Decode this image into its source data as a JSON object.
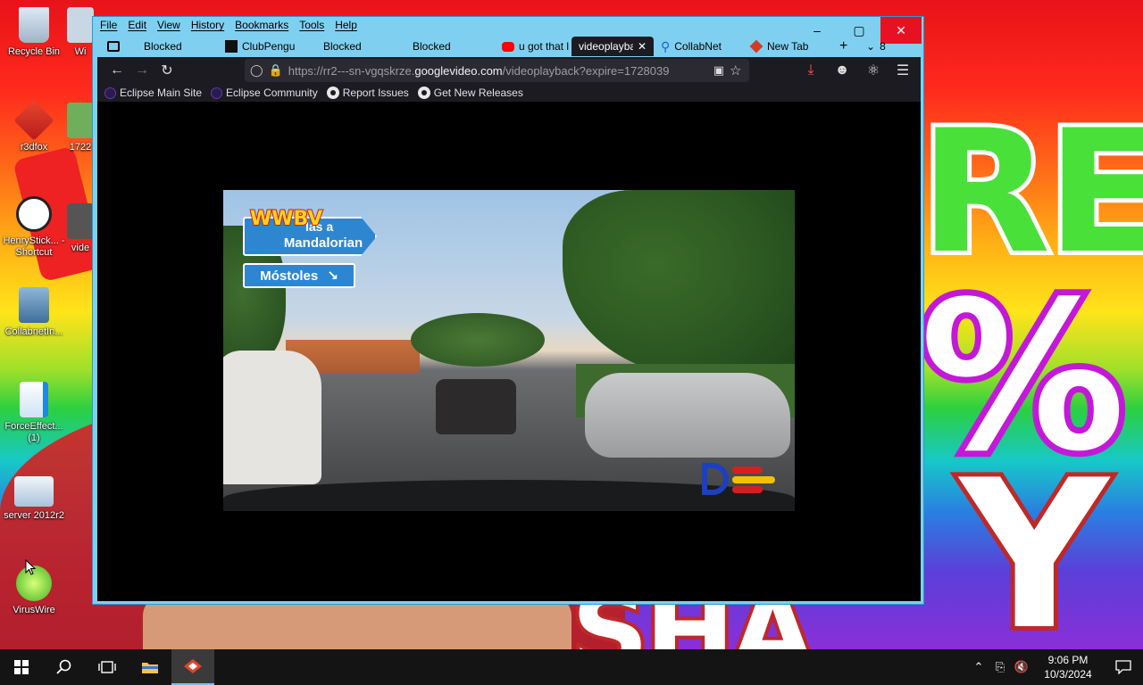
{
  "desktop": {
    "icons": [
      {
        "label": "Recycle Bin"
      },
      {
        "label": "Wi"
      },
      {
        "label": "r3dfox"
      },
      {
        "label": "1722"
      },
      {
        "label": "HenryStick... - Shortcut"
      },
      {
        "label": "vide"
      },
      {
        "label": "CollabnetIn..."
      },
      {
        "label": "ForceEffect... (1)"
      },
      {
        "label": "server 2012r2"
      },
      {
        "label": "VirusWire"
      }
    ]
  },
  "browser": {
    "menu": [
      "File",
      "Edit",
      "View",
      "History",
      "Bookmarks",
      "Tools",
      "Help"
    ],
    "window_controls": {
      "minimize": "–",
      "maximize": "▢",
      "close": "✕"
    },
    "tabs": [
      {
        "label": "Blocked",
        "icon": "tab-list-icon"
      },
      {
        "label": "ClubPengu",
        "icon": "clubpenguin-favicon"
      },
      {
        "label": "Blocked",
        "icon": ""
      },
      {
        "label": "Blocked",
        "icon": ""
      },
      {
        "label": "u got that l",
        "icon": "youtube-favicon"
      },
      {
        "label": "videoplayba",
        "icon": "",
        "active": true
      },
      {
        "label": "CollabNet",
        "icon": "search-favicon"
      },
      {
        "label": "New Tab",
        "icon": "r3dfox-favicon"
      }
    ],
    "new_tab": "+",
    "tab_count": "8",
    "url": {
      "prefix": "https://rr2---sn-vgqskrze.",
      "domain": "googlevideo.com",
      "suffix": "/videoplayback?expire=1728039"
    },
    "bookmarks": [
      {
        "label": "Eclipse Main Site",
        "icon": "eclipse-icon"
      },
      {
        "label": "Eclipse Community",
        "icon": "eclipse-icon"
      },
      {
        "label": "Report Issues",
        "icon": "github-icon"
      },
      {
        "label": "Get New Releases",
        "icon": "github-icon"
      }
    ],
    "video": {
      "watermark": "WWBV",
      "sign_top": "Mandalorian",
      "sign_top_partial": "las a",
      "sign_bottom": "Móstoles"
    }
  },
  "taskbar": {
    "time": "9:06 PM",
    "date": "10/3/2024"
  },
  "colors": {
    "titlebar": "#7fd0f0",
    "browser_dark": "#1c1b22",
    "close_red": "#e81123",
    "taskbar": "#141414"
  }
}
